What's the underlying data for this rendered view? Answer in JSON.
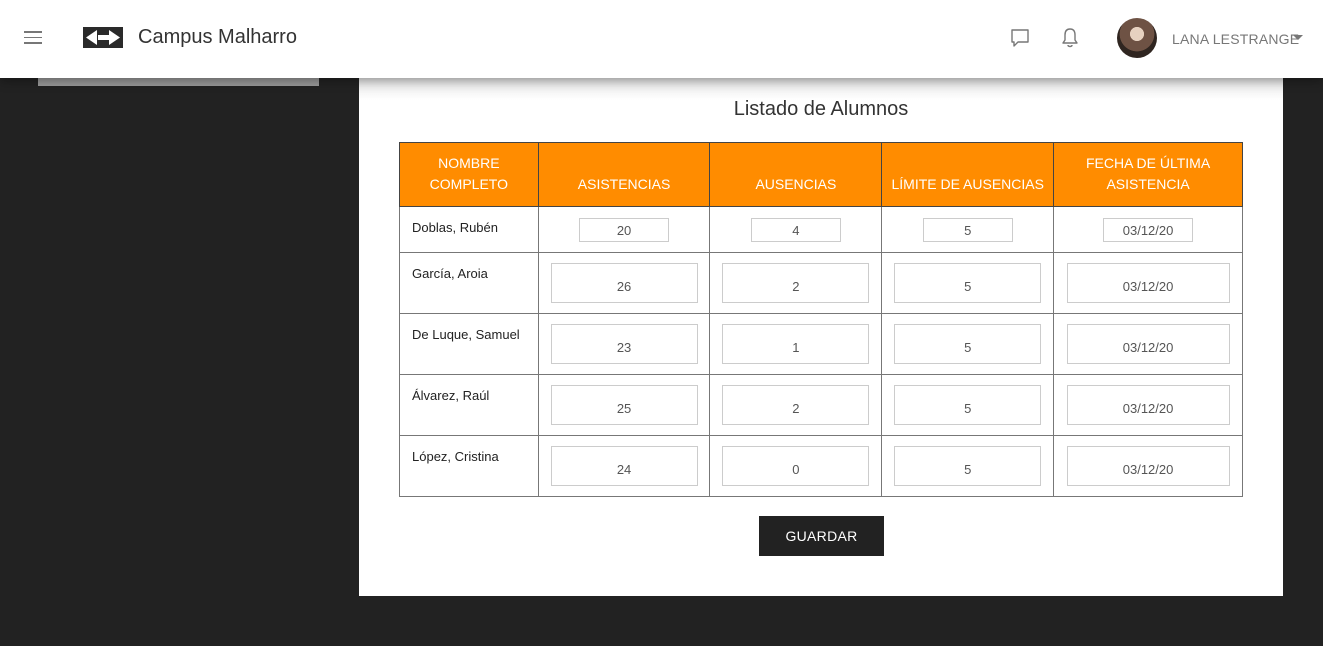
{
  "header": {
    "brand": "Campus Malharro",
    "user_name": "LANA LESTRANGE"
  },
  "icons": [
    "menu-icon",
    "logo-icon",
    "chat-icon",
    "bell-icon",
    "avatar",
    "chevron-down-icon"
  ],
  "colors": {
    "accent": "#ff8c00",
    "page_bg": "#222222",
    "button_bg": "#222222"
  },
  "main": {
    "title": "Listado de Alumnos",
    "columns": [
      "NOMBRE COMPLETO",
      "ASISTENCIAS",
      "AUSENCIAS",
      "LÍMITE DE AUSENCIAS",
      "FECHA DE ÚLTIMA ASISTENCIA"
    ],
    "rows": [
      {
        "name": "Doblas, Rubén",
        "asistencias": "20",
        "ausencias": "4",
        "limite": "5",
        "fecha": "03/12/20"
      },
      {
        "name": "García, Aroia",
        "asistencias": "26",
        "ausencias": "2",
        "limite": "5",
        "fecha": "03/12/20"
      },
      {
        "name": "De Luque, Samuel",
        "asistencias": "23",
        "ausencias": "1",
        "limite": "5",
        "fecha": "03/12/20"
      },
      {
        "name": "Álvarez, Raúl",
        "asistencias": "25",
        "ausencias": "2",
        "limite": "5",
        "fecha": "03/12/20"
      },
      {
        "name": "López, Cristina",
        "asistencias": "24",
        "ausencias": "0",
        "limite": "5",
        "fecha": "03/12/20"
      }
    ],
    "save_label": "GUARDAR"
  }
}
